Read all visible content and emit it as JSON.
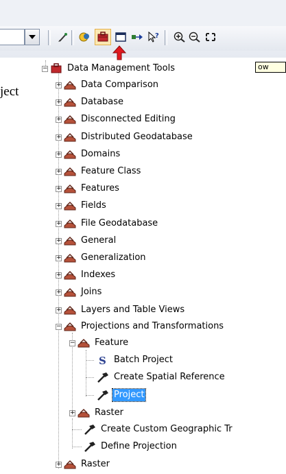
{
  "toolbar": {
    "active_button": "arctoolbox-button"
  },
  "tooltip_text": "ow",
  "left_fragment_text": "ject",
  "tree": {
    "root": "Data Management Tools",
    "toolsets": [
      "Data Comparison",
      "Database",
      "Disconnected Editing",
      "Distributed Geodatabase",
      "Domains",
      "Feature Class",
      "Features",
      "Fields",
      "File Geodatabase",
      "General",
      "Generalization",
      "Indexes",
      "Joins",
      "Layers and Table Views"
    ],
    "projections": {
      "label": "Projections and Transformations",
      "feature": {
        "label": "Feature",
        "tools": [
          "Batch Project",
          "Create Spatial Reference",
          "Project"
        ]
      },
      "raster_sub": "Raster",
      "tools": [
        "Create Custom Geographic Tr",
        "Define Projection"
      ]
    },
    "raster": "Raster",
    "selected": "Project"
  },
  "colors": {
    "selection": "#3399ff",
    "toolbox_red": "#c0282c",
    "highlight_arrow": "#e0191f"
  }
}
